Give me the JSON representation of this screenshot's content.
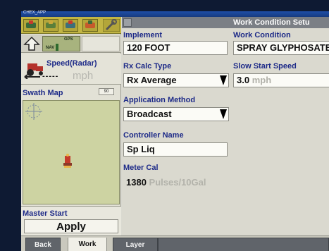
{
  "window": {
    "app_title": "CHEX_APP"
  },
  "toolbar": {
    "buttons": [
      "tractor-icon",
      "sprayer-icon",
      "implement-icon",
      "tools-icon",
      "wrench-icon"
    ]
  },
  "nav": {
    "nav_label": "NAV",
    "gps_label": "GPS"
  },
  "speed": {
    "label": "Speed(Radar)",
    "value": "-----",
    "unit": "mph"
  },
  "swath": {
    "label": "Swath Map",
    "zoom": "90"
  },
  "master": {
    "label": "Master Start",
    "button": "Apply"
  },
  "panel": {
    "title": "Work Condition Setu"
  },
  "fields": {
    "implement": {
      "label": "Implement",
      "value": "120 FOOT"
    },
    "work_condition": {
      "label": "Work Condition",
      "value": "SPRAY GLYPHOSATE"
    },
    "rx_calc_type": {
      "label": "Rx Calc Type",
      "value": "Rx Average"
    },
    "slow_start_speed": {
      "label": "Slow Start Speed",
      "value": "3.0",
      "unit": "mph"
    },
    "application_method": {
      "label": "Application Method",
      "value": "Broadcast"
    },
    "controller_name": {
      "label": "Controller Name",
      "value": "Sp Liq"
    },
    "meter_cal": {
      "label": "Meter Cal",
      "value": "1380",
      "unit": "Pulses/10Gal"
    }
  },
  "tabs": {
    "back": "Back",
    "work": "Work",
    "layer": "Layer"
  },
  "colors": {
    "label_blue": "#1d2a88",
    "toolbar_yellow": "#c2b544",
    "header_gray": "#7b7f85"
  }
}
